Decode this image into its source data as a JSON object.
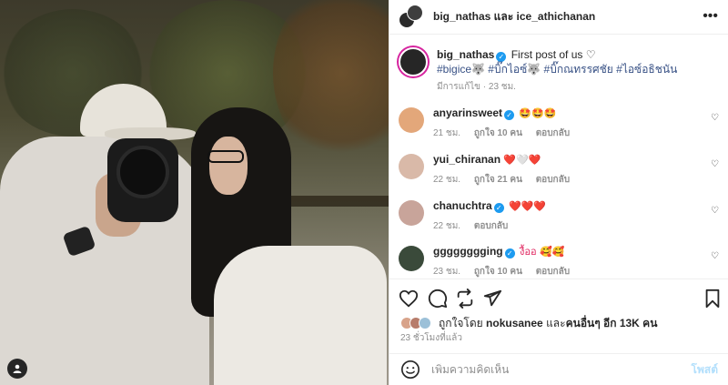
{
  "header": {
    "names": "big_nathas และ ice_athichanan",
    "more_icon": "more-horizontal-icon",
    "more_glyph": "•••"
  },
  "caption": {
    "username": "big_nathas",
    "text": "First post of us ♡",
    "hashtags": "#bigice🐺 #บิ๊กไอซ์🐺 #บิ๊กณทรรศชัย #ไอซ์อธิชนัน",
    "meta": "มีการแก้ไข · 23 ชม."
  },
  "comments": [
    {
      "username": "anyarinsweet",
      "verified": true,
      "text": "🤩🤩🤩",
      "time": "21 ชม.",
      "likes": "ถูกใจ 10 คน",
      "reply": "ตอบกลับ",
      "avatar_color": "#e3a77a"
    },
    {
      "username": "yui_chiranan",
      "verified": false,
      "text": "❤️🤍❤️",
      "time": "22 ชม.",
      "likes": "ถูกใจ 21 คน",
      "reply": "ตอบกลับ",
      "avatar_color": "#d9b9a8"
    },
    {
      "username": "chanuchtra",
      "verified": true,
      "text": "❤️❤️❤️",
      "time": "22 ชม.",
      "likes": "",
      "reply": "ตอบกลับ",
      "avatar_color": "#c8a49a"
    },
    {
      "username": "gggggggging",
      "verified": true,
      "text": "งื้ออ 🥰🥰",
      "time": "23 ชม.",
      "likes": "ถูกใจ 10 คน",
      "reply": "ตอบกลับ",
      "avatar_color": "#3a4a3a"
    }
  ],
  "icons": {
    "like": "heart-icon",
    "comment": "comment-icon",
    "share": "share-icon",
    "send": "send-icon",
    "save": "bookmark-icon",
    "emoji": "emoji-icon",
    "user_tag": "user-tag-icon",
    "comment_like": "small-heart-icon"
  },
  "likes": {
    "prefix": "ถูกใจโดย ",
    "user": "nokusanee",
    "middle": " และ",
    "others": "คนอื่นๆ อีก 13K คน"
  },
  "time_ago": "23 ชั่วโมงที่แล้ว",
  "add_comment": {
    "placeholder": "เพิ่มความคิดเห็น",
    "post_label": "โพสต์"
  },
  "colors": {
    "verified": "#1d9bf0",
    "hashtag": "#385185",
    "post_disabled": "#b2dffc",
    "story_ring": "#d6249f"
  }
}
